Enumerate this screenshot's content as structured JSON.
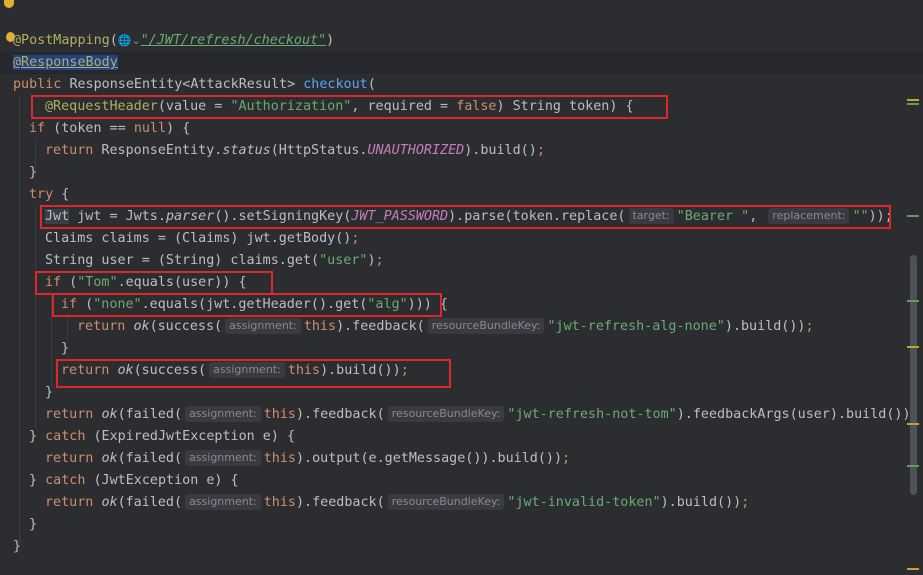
{
  "code": {
    "ann_postmapping": "@PostMapping",
    "path_icon": "🌐⌄",
    "path_value": "\"/JWT/refresh/checkout\"",
    "ann_responsebody": "@ResponseBody",
    "public_kw": "public",
    "return_type": "ResponseEntity<AttackResult>",
    "method_name": "checkout",
    "ann_requestheader": "@RequestHeader",
    "header_value": "\"Authorization\"",
    "false_kw": "false",
    "if_kw": "if",
    "null_kw": "null",
    "return_kw": "return",
    "status_method": "status",
    "unauthorized": "UNAUTHORIZED",
    "try_kw": "try",
    "jwt_type": "Jwt",
    "parser_method": "parser",
    "jwt_password": "JWT_PASSWORD",
    "hint_target": "target:",
    "bearer": "\"Bearer \"",
    "hint_replacement": "replacement:",
    "empty_str": "\"\"",
    "user_str": "\"user\"",
    "tom_str": "\"Tom\"",
    "none_str": "\"none\"",
    "alg_str": "\"alg\"",
    "ok_method": "ok",
    "hint_assignment": "assignment:",
    "this_kw": "this",
    "hint_rbk": "resourceBundleKey:",
    "alg_none_key": "\"jwt-refresh-alg-none\"",
    "not_tom_key": "\"jwt-refresh-not-tom\"",
    "catch_kw": "catch",
    "invalid_token_key": "\"jwt-invalid-token\""
  },
  "colors": {
    "background": "#2b2d30",
    "keyword": "#cf8e6d",
    "annotation": "#b3ae60",
    "string": "#6aab73",
    "function": "#56a8f5",
    "constant": "#c77dbb",
    "highlight_box": "#e0262b"
  }
}
